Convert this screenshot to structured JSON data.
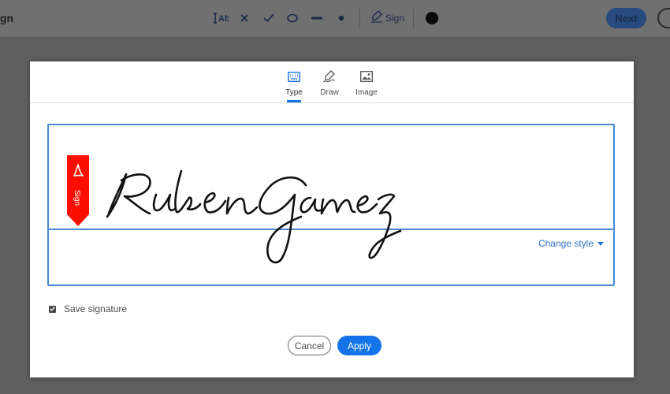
{
  "toolbar": {
    "title_fragment": "gn",
    "sign_label": "Sign",
    "next_label": "Next",
    "icons": [
      "text-field-icon",
      "cross-icon",
      "checkmark-icon",
      "ellipse-icon",
      "line-icon",
      "dot-icon",
      "sign-pen-icon",
      "color-circle-icon"
    ]
  },
  "dialog": {
    "tabs": [
      {
        "label": "Type",
        "icon": "keyboard-icon",
        "active": true
      },
      {
        "label": "Draw",
        "icon": "pen-icon",
        "active": false
      },
      {
        "label": "Image",
        "icon": "image-icon",
        "active": false
      }
    ],
    "signature_text": "Ruben Gamez",
    "flag_text": "Sign",
    "change_style_label": "Change style",
    "save_signature_label": "Save signature",
    "save_signature_checked": true,
    "cancel_label": "Cancel",
    "apply_label": "Apply"
  },
  "colors": {
    "accent": "#1473e6",
    "flag_red": "#fa0f00",
    "link_blue": "#2a73c9"
  }
}
